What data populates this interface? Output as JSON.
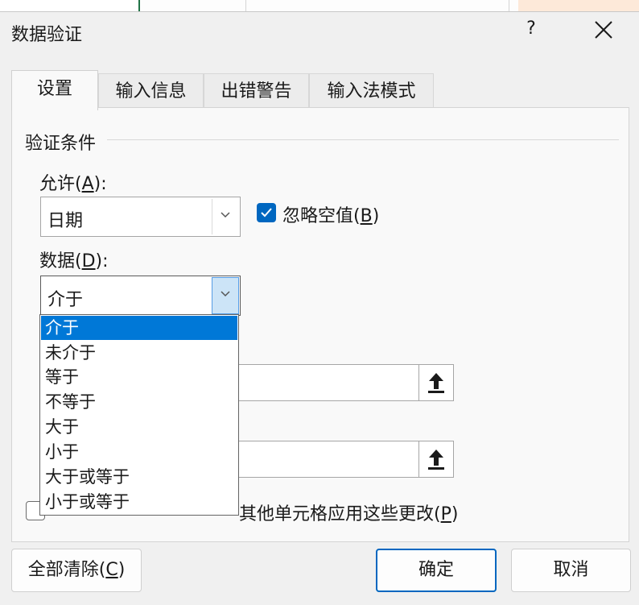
{
  "dialog": {
    "title": "数据验证",
    "help": "?"
  },
  "tabs": [
    {
      "label": "设置",
      "active": true
    },
    {
      "label": "输入信息",
      "active": false
    },
    {
      "label": "出错警告",
      "active": false
    },
    {
      "label": "输入法模式",
      "active": false
    }
  ],
  "settings": {
    "group_label": "验证条件",
    "allow": {
      "label_pre": "允许(",
      "key": "A",
      "label_post": "):",
      "value": "日期"
    },
    "ignore_blank": {
      "label_pre": "忽略空值(",
      "key": "B",
      "label_post": ")",
      "checked": true
    },
    "data": {
      "label_pre": "数据(",
      "key": "D",
      "label_post": "):",
      "value": "介于",
      "options": [
        "介于",
        "未介于",
        "等于",
        "不等于",
        "大于",
        "小于",
        "大于或等于",
        "小于或等于"
      ],
      "selected_index": 0
    },
    "apply_all": {
      "label_visible": "其他单元格应用这些更改(",
      "key": "P",
      "label_post": ")",
      "checked": false
    }
  },
  "buttons": {
    "clear_all": {
      "label_pre": "全部清除(",
      "key": "C",
      "label_post": ")"
    },
    "ok": "确定",
    "cancel": "取消"
  },
  "colors": {
    "accent": "#0067c0",
    "selection": "#0078d7"
  }
}
